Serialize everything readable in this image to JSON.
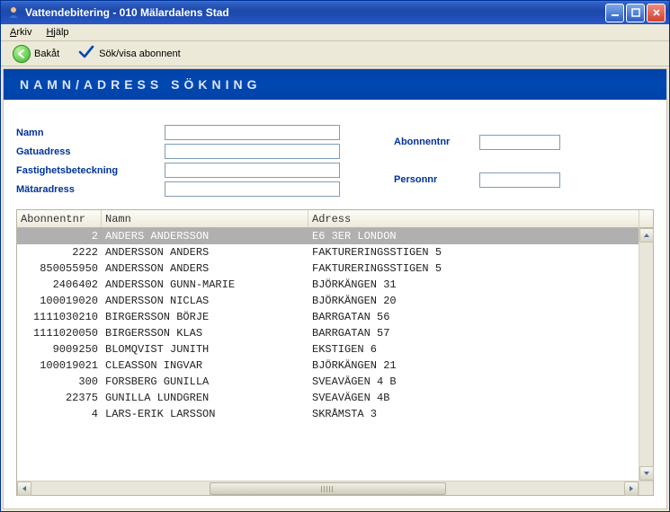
{
  "window": {
    "title": "Vattendebitering  -  010 Mälardalens Stad"
  },
  "menu": {
    "arkiv": "Arkiv",
    "arkiv_acc": "A",
    "arkiv_rest": "rkiv",
    "hjalp": "Hjälp",
    "hjalp_acc": "H",
    "hjalp_rest": "jälp"
  },
  "toolbar": {
    "back": "Bakåt",
    "search": "Sök/visa abonnent"
  },
  "page": {
    "header": "NAMN/ADRESS SÖKNING"
  },
  "form": {
    "namn_label": "Namn",
    "gatuadress_label": "Gatuadress",
    "fastighet_label": "Fastighetsbeteckning",
    "matar_label": "Mätaradress",
    "abonnentnr_label": "Abonnentnr",
    "personnr_label": "Personnr",
    "namn": "",
    "gatuadress": "",
    "fastighet": "",
    "matar": "",
    "abonnentnr": "",
    "personnr": ""
  },
  "table": {
    "headers": {
      "abonnentnr": "Abonnentnr",
      "namn": "Namn",
      "adress": "Adress"
    },
    "rows": [
      {
        "abn": "2",
        "namn": "ANDERS ANDERSSON",
        "adr": "E6 3ER LONDON",
        "selected": true
      },
      {
        "abn": "2222",
        "namn": "ANDERSSON ANDERS",
        "adr": "FAKTURERINGSSTIGEN 5"
      },
      {
        "abn": "850055950",
        "namn": "ANDERSSON ANDERS",
        "adr": "FAKTURERINGSSTIGEN 5"
      },
      {
        "abn": "2406402",
        "namn": "ANDERSSON GUNN-MARIE",
        "adr": "BJÖRKÄNGEN 31"
      },
      {
        "abn": "100019020",
        "namn": "ANDERSSON NICLAS",
        "adr": "BJÖRKÄNGEN 20"
      },
      {
        "abn": "1111030210",
        "namn": "BIRGERSSON BÖRJE",
        "adr": "BARRGATAN 56"
      },
      {
        "abn": "1111020050",
        "namn": "BIRGERSSON KLAS",
        "adr": "BARRGATAN 57"
      },
      {
        "abn": "9009250",
        "namn": "BLOMQVIST JUNITH",
        "adr": "EKSTIGEN 6"
      },
      {
        "abn": "100019021",
        "namn": "CLEASSON INGVAR",
        "adr": "BJÖRKÄNGEN 21"
      },
      {
        "abn": "300",
        "namn": "FORSBERG GUNILLA",
        "adr": "SVEAVÄGEN 4 B"
      },
      {
        "abn": "22375",
        "namn": "GUNILLA LUNDGREN",
        "adr": "SVEAVÄGEN 4B"
      },
      {
        "abn": "4",
        "namn": "LARS-ERIK LARSSON",
        "adr": "SKRÅMSTA 3"
      }
    ]
  }
}
